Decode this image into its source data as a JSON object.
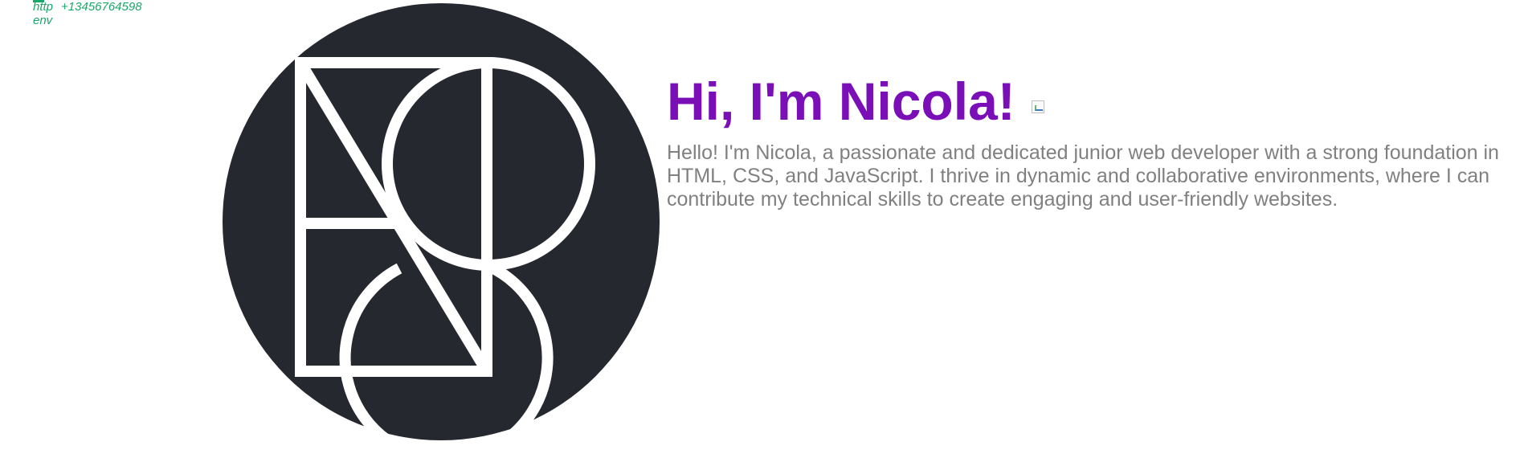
{
  "contact": {
    "link_label_top": "http",
    "link_label_bottom": "env",
    "phone": "+13456764598"
  },
  "logo": {
    "icon": "ng-monogram-logo",
    "circle_color": "#262830",
    "line_color": "#ffffff"
  },
  "hero": {
    "title": "Hi, I'm Nicola!",
    "greeting_image": "broken-image-icon",
    "intro": "Hello! I'm Nicola, a passionate and dedicated junior web developer with a strong foundation in HTML, CSS, and JavaScript. I thrive in dynamic and collaborative environments, where I can contribute my technical skills to create engaging and user-friendly websites."
  },
  "colors": {
    "title": "#7a0fb8",
    "intro_text": "#808080",
    "contact_text": "#1aa86a"
  }
}
